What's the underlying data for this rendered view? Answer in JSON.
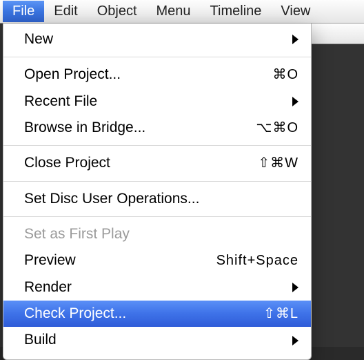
{
  "menubar": {
    "items": [
      {
        "label": "File",
        "active": true
      },
      {
        "label": "Edit"
      },
      {
        "label": "Object"
      },
      {
        "label": "Menu"
      },
      {
        "label": "Timeline"
      },
      {
        "label": "View"
      }
    ]
  },
  "fileMenu": {
    "groups": [
      [
        {
          "label": "New",
          "submenu": true
        }
      ],
      [
        {
          "label": "Open Project...",
          "shortcut": "⌘O"
        },
        {
          "label": "Recent File",
          "submenu": true
        },
        {
          "label": "Browse in Bridge...",
          "shortcut": "⌥⌘O"
        }
      ],
      [
        {
          "label": "Close Project",
          "shortcut": "⇧⌘W"
        }
      ],
      [
        {
          "label": "Set Disc User Operations..."
        }
      ],
      [
        {
          "label": "Set as First Play",
          "disabled": true
        },
        {
          "label": "Preview",
          "shortcut": "Shift+Space"
        },
        {
          "label": "Render",
          "submenu": true
        },
        {
          "label": "Check Project...",
          "shortcut": "⇧⌘L",
          "highlight": true
        },
        {
          "label": "Build",
          "submenu": true
        }
      ]
    ]
  }
}
